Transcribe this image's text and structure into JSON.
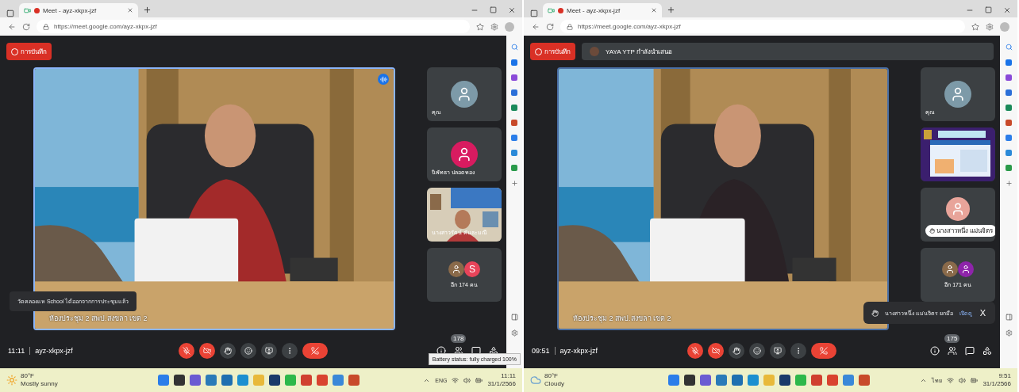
{
  "windows": [
    {
      "tab": {
        "title": "Meet - ayz-xkpx-jzf",
        "recording": true
      },
      "url": "https://meet.google.com/ayz-xkpx-jzf",
      "recording_label": "การบันทึก",
      "main_video": {
        "name": "ห้องประชุม 2 สพป.สงขลา เขต 2",
        "speaking": true
      },
      "tiles": [
        {
          "kind": "avatar",
          "name": "คุณ",
          "color": "#7d9aa8"
        },
        {
          "kind": "avatar",
          "name": "นิพัทธา ปลอดทอง",
          "color": "#d81b60"
        },
        {
          "kind": "video",
          "name": "นางสาวรัตน์ คันธะมณี"
        },
        {
          "kind": "others",
          "label": "อีก 174 คน",
          "initial": "S",
          "color": "#e8445a"
        }
      ],
      "toast": "วัดคลองแห School ได้ออกจากการประชุมแล้ว",
      "time": "11:11",
      "code": "ayz-xkpx-jzf",
      "mic_on": false,
      "camera_on": false,
      "participant_count": "178",
      "tooltip": "Battery status: fully charged 100%",
      "taskbar": {
        "temperature": "80°F",
        "weather": "Mostly sunny",
        "language": "ENG",
        "clock": "11:11",
        "date": "31/1/2566"
      }
    },
    {
      "tab": {
        "title": "Meet - ayz-xkpx-jzf",
        "recording": true
      },
      "url": "https://meet.google.com/ayz-xkpx-jzf",
      "recording_label": "การบันทึก",
      "presenter": "YAYA YTP กำลังนำเสนอ",
      "main_video": {
        "name": "ห้องประชุม 2 สพป.สงขลา เขต 2",
        "speaking": false
      },
      "tiles": [
        {
          "kind": "avatar",
          "name": "คุณ",
          "color": "#7d9aa8"
        },
        {
          "kind": "slide"
        },
        {
          "kind": "chip",
          "name": "นางสาวหนึ่ง แม่นจิตร"
        },
        {
          "kind": "others",
          "label": "อีก 171 คน",
          "color": "#8e24aa"
        }
      ],
      "notification": {
        "text": "นางสาวหนึ่ง แม่นจิตร ยกมือ",
        "action": "เปิดดู",
        "close": "X"
      },
      "time": "09:51",
      "code": "ayz-xkpx-jzf",
      "mic_on": false,
      "camera_on": false,
      "participant_count": "175",
      "taskbar": {
        "temperature": "80°F",
        "weather": "Cloudy",
        "language": "ไทย",
        "clock": "9:51",
        "date": "31/1/2566"
      }
    }
  ]
}
